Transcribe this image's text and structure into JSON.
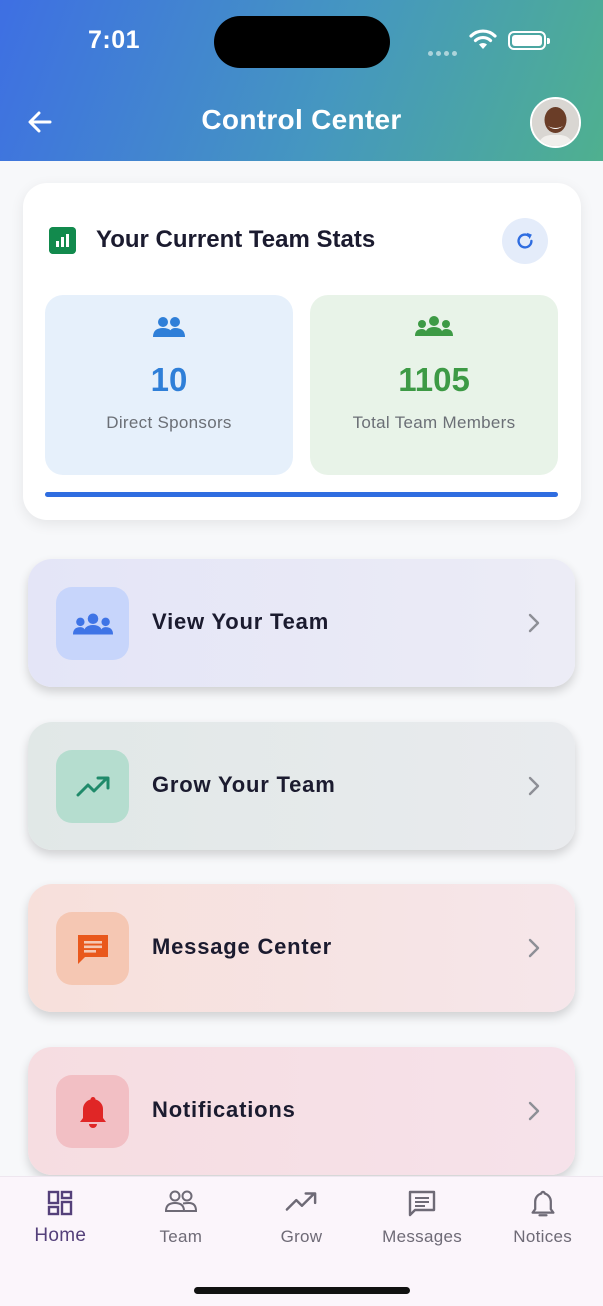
{
  "status_bar": {
    "time": "7:01"
  },
  "header": {
    "title": "Control Center"
  },
  "stats": {
    "title": "Your Current Team Stats",
    "direct_sponsors": {
      "value": "10",
      "label": "Direct Sponsors"
    },
    "total_team": {
      "value": "1105",
      "label": "Total Team Members"
    },
    "progress_fraction": 1.0
  },
  "menu": [
    {
      "label": "View Your Team",
      "icon": "groups-icon",
      "color": "#3f74e6"
    },
    {
      "label": "Grow Your Team",
      "icon": "trending-up-icon",
      "color": "#1f8a6a"
    },
    {
      "label": "Message Center",
      "icon": "chat-icon",
      "color": "#e9581c"
    },
    {
      "label": "Notifications",
      "icon": "bell-icon",
      "color": "#e02626"
    }
  ],
  "bottom_nav": [
    {
      "label": "Home",
      "icon": "dashboard-icon",
      "active": true
    },
    {
      "label": "Team",
      "icon": "people-icon",
      "active": false
    },
    {
      "label": "Grow",
      "icon": "trending-up-icon",
      "active": false
    },
    {
      "label": "Messages",
      "icon": "message-icon",
      "active": false
    },
    {
      "label": "Notices",
      "icon": "bell-icon",
      "active": false
    }
  ],
  "colors": {
    "header_gradient_start": "#3e6fe3",
    "header_gradient_end": "#4fb08f",
    "accent_blue": "#2f7fd8",
    "accent_green": "#3d9a45",
    "nav_active": "#54407a"
  }
}
